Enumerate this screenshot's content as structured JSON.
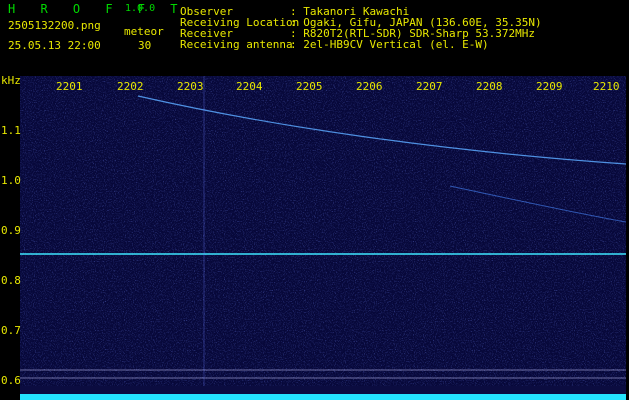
{
  "app": {
    "name": "H R O F F T",
    "version": "1.0.0"
  },
  "meta": {
    "filename": "2505132200.png",
    "datetime": "25.05.13 22:00",
    "label": "meteor",
    "count": "30"
  },
  "observer": {
    "labels": [
      "Observer",
      "Receiving Location",
      "Receiver",
      "Receiving antenna"
    ],
    "values": [
      ": Takanori Kawachi",
      ": Ogaki, Gifu, JAPAN (136.60E, 35.35N)",
      ": R820T2(RTL-SDR) SDR-Sharp 53.372MHz",
      ": 2el-HB9CV Vertical (el. E-W)"
    ]
  },
  "x_ticks": [
    "2201",
    "2202",
    "2203",
    "2204",
    "2205",
    "2206",
    "2207",
    "2208",
    "2209",
    "2210"
  ],
  "y_unit": "kHz",
  "y_ticks": [
    "1.1",
    "1.0",
    "0.9",
    "0.8",
    "0.7",
    "0.6"
  ],
  "colors": {
    "accent": "#e8e800",
    "brand": "#00d800",
    "signal": "#24e4ff",
    "background": "#07083a"
  }
}
